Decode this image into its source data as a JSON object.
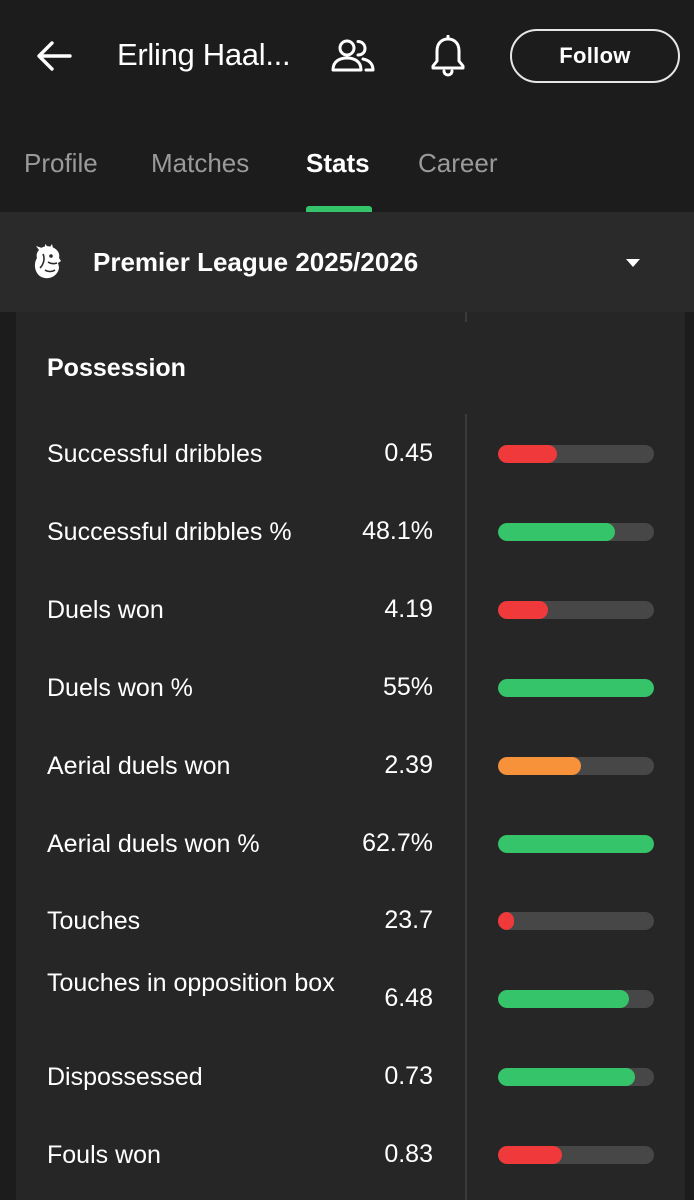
{
  "header": {
    "title": "Erling Haal...",
    "follow_label": "Follow"
  },
  "tabs": [
    {
      "label": "Profile",
      "active": false
    },
    {
      "label": "Matches",
      "active": false
    },
    {
      "label": "Stats",
      "active": true
    },
    {
      "label": "Career",
      "active": false
    }
  ],
  "league": {
    "name": "Premier League 2025/2026"
  },
  "section": {
    "title": "Possession"
  },
  "colors": {
    "green": "#35c46a",
    "red": "#f0393a",
    "orange": "#f7923b",
    "track": "#474747",
    "accent": "#35c46a"
  },
  "stats": [
    {
      "label": "Successful dribbles",
      "value": "0.45",
      "percentile": 0.38,
      "color": "red"
    },
    {
      "label": "Successful dribbles %",
      "value": "48.1%",
      "percentile": 0.75,
      "color": "green"
    },
    {
      "label": "Duels won",
      "value": "4.19",
      "percentile": 0.32,
      "color": "red"
    },
    {
      "label": "Duels won %",
      "value": "55%",
      "percentile": 1.0,
      "color": "green"
    },
    {
      "label": "Aerial duels won",
      "value": "2.39",
      "percentile": 0.53,
      "color": "orange"
    },
    {
      "label": "Aerial duels won %",
      "value": "62.7%",
      "percentile": 1.0,
      "color": "green"
    },
    {
      "label": "Touches",
      "value": "23.7",
      "percentile": 0.1,
      "color": "red"
    },
    {
      "label": "Touches in opposition box",
      "value": "6.48",
      "percentile": 0.84,
      "color": "green"
    },
    {
      "label": "Dispossessed",
      "value": "0.73",
      "percentile": 0.88,
      "color": "green"
    },
    {
      "label": "Fouls won",
      "value": "0.83",
      "percentile": 0.41,
      "color": "red"
    }
  ]
}
